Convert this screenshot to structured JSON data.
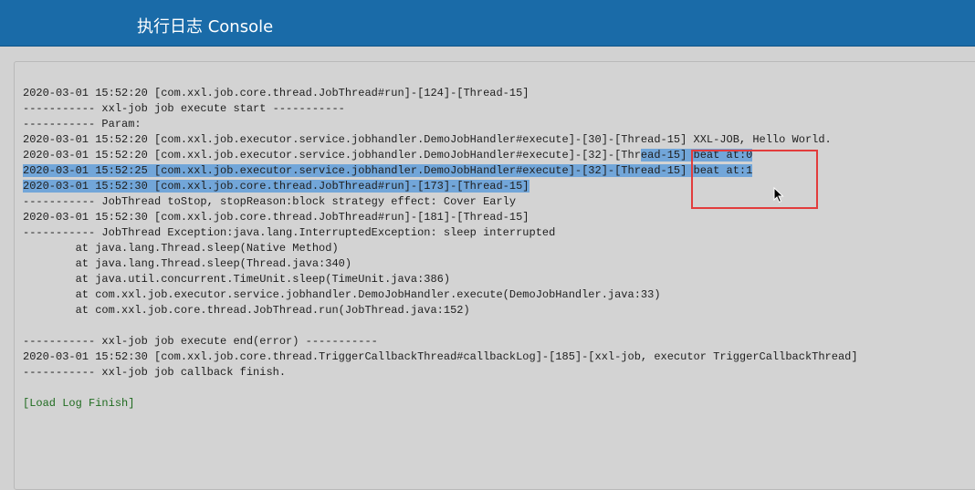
{
  "header": {
    "title": "执行日志 Console"
  },
  "log": {
    "lines": [
      "2020-03-01 15:52:20 [com.xxl.job.core.thread.JobThread#run]-[124]-[Thread-15]",
      "----------- xxl-job job execute start -----------",
      "----------- Param:",
      "2020-03-01 15:52:20 [com.xxl.job.executor.service.jobhandler.DemoJobHandler#execute]-[30]-[Thread-15] XXL-JOB, Hello World.",
      "2020-03-01 15:52:20 [com.xxl.job.executor.service.jobhandler.DemoJobHandler#execute]-[32]-[Thr",
      "ead-15] beat at:0",
      "2020-03-01 15:52:25 [com.xxl.job.executor.service.jobhandler.DemoJobHandler#execute]-[32]-[Thread-15] beat at:1",
      "2020-03-01 15:52:30 [com.xxl.job.core.thread.JobThread#run]-[173]-[Thread-15]",
      "----------- JobThread toStop, stopReason:block strategy effect: Cover Early",
      "2020-03-01 15:52:30 [com.xxl.job.core.thread.JobThread#run]-[181]-[Thread-15]",
      "----------- JobThread Exception:java.lang.InterruptedException: sleep interrupted",
      "        at java.lang.Thread.sleep(Native Method)",
      "        at java.lang.Thread.sleep(Thread.java:340)",
      "        at java.util.concurrent.TimeUnit.sleep(TimeUnit.java:386)",
      "        at com.xxl.job.executor.service.jobhandler.DemoJobHandler.execute(DemoJobHandler.java:33)",
      "        at com.xxl.job.core.thread.JobThread.run(JobThread.java:152)",
      "",
      "----------- xxl-job job execute end(error) -----------",
      "2020-03-01 15:52:30 [com.xxl.job.core.thread.TriggerCallbackThread#callbackLog]-[185]-[xxl-job, executor TriggerCallbackThread]",
      "----------- xxl-job job callback finish.",
      "",
      "[Load Log Finish]"
    ]
  },
  "colors": {
    "header_bg": "#1a6ba8",
    "selection": "#72a6d9",
    "annotation_box": "#e23c3c",
    "finish_text": "#1f6b1f"
  },
  "icons": {
    "cursor": "mouse-pointer-icon"
  }
}
